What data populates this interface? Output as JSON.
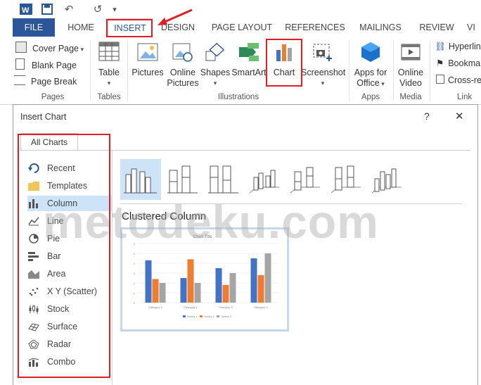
{
  "quick_access": {
    "undo_glyph": "↶",
    "redo_glyph": "↺",
    "more_glyph": "▾"
  },
  "ribbon_tabs": [
    "FILE",
    "HOME",
    "INSERT",
    "DESIGN",
    "PAGE LAYOUT",
    "REFERENCES",
    "MAILINGS",
    "REVIEW",
    "VI"
  ],
  "ribbon": {
    "pages": {
      "cover_page": "Cover Page",
      "blank_page": "Blank Page",
      "page_break": "Page Break",
      "group": "Pages"
    },
    "tables": {
      "table": "Table",
      "group": "Tables"
    },
    "illustrations": {
      "pictures": "Pictures",
      "online_pictures_1": "Online",
      "online_pictures_2": "Pictures",
      "shapes": "Shapes",
      "smartart": "SmartArt",
      "chart": "Chart",
      "screenshot": "Screenshot",
      "group": "Illustrations"
    },
    "apps": {
      "apps_1": "Apps for",
      "apps_2": "Office",
      "group": "Apps"
    },
    "media": {
      "online_video_1": "Online",
      "online_video_2": "Video",
      "group": "Media"
    },
    "links": {
      "hyperlink": "Hyperlin",
      "bookmark": "Bookma",
      "crossref": "Cross-re",
      "group": "Link"
    }
  },
  "dialog": {
    "title": "Insert Chart",
    "help": "?",
    "close": "✕",
    "tab": "All Charts",
    "categories": [
      "Recent",
      "Templates",
      "Column",
      "Line",
      "Pie",
      "Bar",
      "Area",
      "X Y (Scatter)",
      "Stock",
      "Surface",
      "Radar",
      "Combo"
    ],
    "selected_category": "Column",
    "subtype_title": "Clustered Column",
    "preview": {
      "chart_title": "Chart Title",
      "categories": [
        "Category 1",
        "Category 2",
        "Category 3",
        "Category 4"
      ],
      "series": [
        {
          "name": "Series 1",
          "values": [
            4.3,
            2.5,
            3.5,
            4.5
          ],
          "color": "#4472c4"
        },
        {
          "name": "Series 2",
          "values": [
            2.4,
            4.4,
            1.8,
            2.8
          ],
          "color": "#ed7d31"
        },
        {
          "name": "Series 3",
          "values": [
            2,
            2,
            3,
            5
          ],
          "color": "#a5a5a5"
        }
      ],
      "ylim": [
        0,
        6
      ]
    }
  },
  "watermark": "metodeku.com",
  "colors": {
    "accent": "#2b579a",
    "highlight_red": "#e01f26",
    "selection": "#cde3f7"
  }
}
